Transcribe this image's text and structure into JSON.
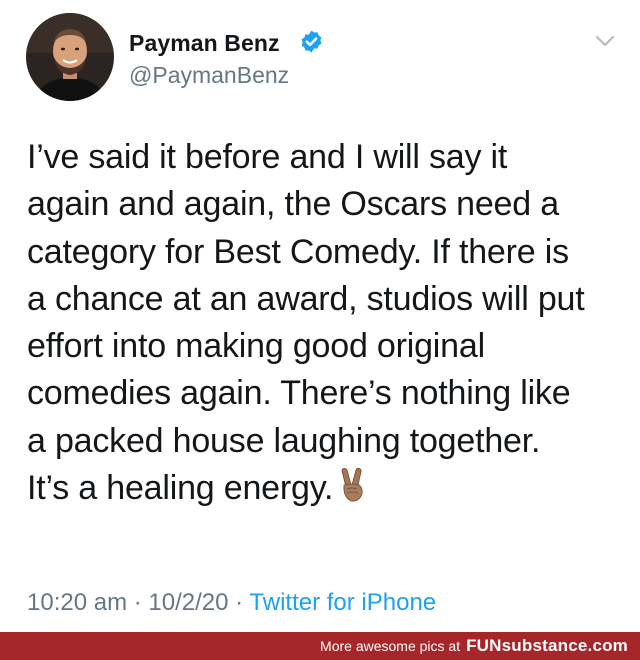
{
  "author": {
    "name": "Payman Benz",
    "handle": "@PaymanBenz",
    "avatar_icon": "profile-photo",
    "verified_icon": "verified-badge-icon",
    "verified_color": "#1da1f2"
  },
  "tweet": {
    "lines": [
      "I’ve said it before and I will say it",
      "again and again, the Oscars need a",
      "category for Best Comedy. If there is",
      "a chance at an award, studios will put",
      "effort into making good original",
      "comedies again. There’s nothing like",
      "a packed house laughing together.",
      "It’s a healing energy."
    ],
    "emoji": "victory-hand-emoji",
    "time": "10:20 am",
    "separator": "·",
    "date": "10/2/20",
    "source": "Twitter for iPhone"
  },
  "menu": {
    "icon": "chevron-down-icon"
  },
  "watermark": {
    "tagline": "More awesome pics at",
    "brand": "FUNsubstance.com",
    "background": "#a5272a"
  },
  "colors": {
    "text": "#14171a",
    "secondary": "#657786",
    "link": "#1da1f2"
  }
}
